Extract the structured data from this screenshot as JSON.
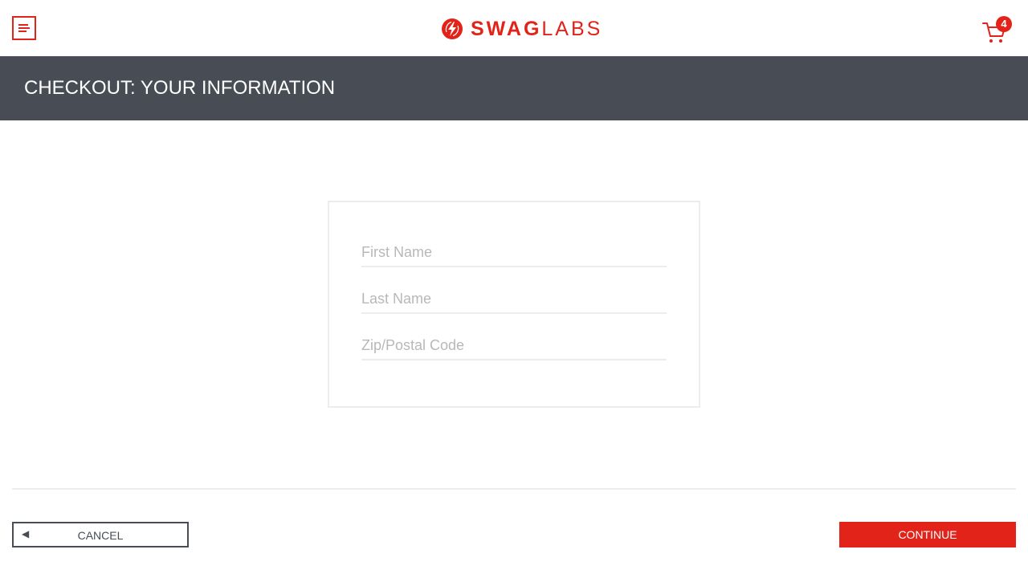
{
  "header": {
    "menu_icon": "hamburger-menu-icon",
    "logo": {
      "swag": "SWAG",
      "labs": "LABS",
      "icon": "lightning-bolt-logo-icon"
    },
    "cart": {
      "icon": "shopping-cart-icon",
      "count": "4"
    }
  },
  "page": {
    "title": "CHECKOUT: YOUR INFORMATION"
  },
  "form": {
    "first_name": {
      "placeholder": "First Name",
      "value": ""
    },
    "last_name": {
      "placeholder": "Last Name",
      "value": ""
    },
    "postal_code": {
      "placeholder": "Zip/Postal Code",
      "value": ""
    }
  },
  "actions": {
    "cancel_label": "CANCEL",
    "cancel_icon": "◀",
    "continue_label": "CONTINUE"
  },
  "colors": {
    "accent": "#e2231a",
    "title_bar": "#474c55",
    "border": "#ededed"
  }
}
